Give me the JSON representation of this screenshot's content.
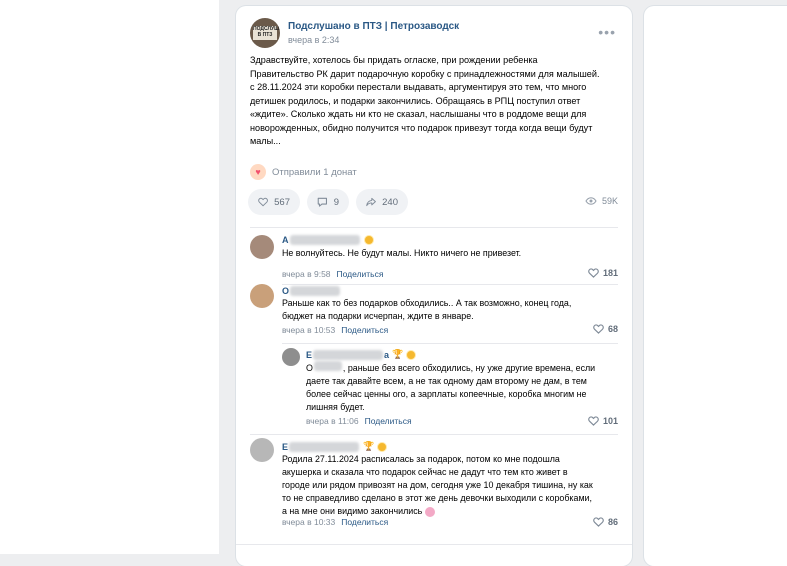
{
  "post": {
    "group_name": "Подслушано в ПТЗ | Петрозаводск",
    "avatar_caption": "ПОДСЛУШАНО В ПТЗ",
    "time": "вчера в 2:34",
    "text_lines": [
      "Здравствуйте, хотелось бы придать огласке, при рождении ребенка",
      "Правительство РК дарит подарочную коробку с принадлежностями для малышей.",
      "с 28.11.2024 эти коробки перестали выдавать, аргументируя это тем, что много",
      "детишек родилось, и подарки закончились. Обращаясь в РПЦ поступил ответ",
      "«ждите». Сколько ждать ни кто не сказал, наслышаны что в роддоме вещи для",
      "новорожденных, обидно получится что подарок привезут тогда когда вещи будут",
      "малы..."
    ],
    "donate_text": "Отправили 1 донат",
    "likes": "567",
    "comments": "9",
    "shares": "240",
    "views": "59K"
  },
  "comments": [
    {
      "name_initial": "А",
      "text_lines": [
        "Не волнуйтесь. Не будут малы. Никто ничего не привезет."
      ],
      "time": "вчера в 9:58",
      "share_label": "Поделиться",
      "likes": "181"
    },
    {
      "name_initial": "О",
      "text_lines": [
        "Раньше как то без подарков обходились.. А так возможно, конец года,",
        "бюджет на подарки исчерпан, ждите в январе."
      ],
      "time": "вчера в 10:53",
      "share_label": "Поделиться",
      "likes": "68"
    },
    {
      "name_initial": "Е",
      "name_suffix": "а",
      "text_first": "О",
      "text_lines": [
        ", раньше без всего обходились, ну уже другие времена, если",
        "даете так давайте всем, а не так одному дам второму не дам, в тем",
        "более сейчас ценны ого, а зарплаты копеечные, коробка многим не",
        "лишняя будет."
      ],
      "time": "вчера в 11:06",
      "share_label": "Поделиться",
      "likes": "101"
    },
    {
      "name_initial": "Е",
      "text_lines": [
        "Родила 27.11.2024 расписалась за подарок, потом ко мне подошла",
        "акушерка и сказала что подарок сейчас не дадут что тем кто живет в",
        "городе или рядом привозят на дом, сегодня уже 10 декабря тишина, ну как",
        "то не справедливо сделано в этот же день девочки выходили с коробками,",
        "а на мне они видимо закончились"
      ],
      "time": "вчера в 10:33",
      "share_label": "Поделиться",
      "likes": "86"
    }
  ],
  "colors": {
    "link": "#2a5885",
    "muted": "#818c99",
    "donate": "#f2516d",
    "badge": "#f5b82e"
  }
}
